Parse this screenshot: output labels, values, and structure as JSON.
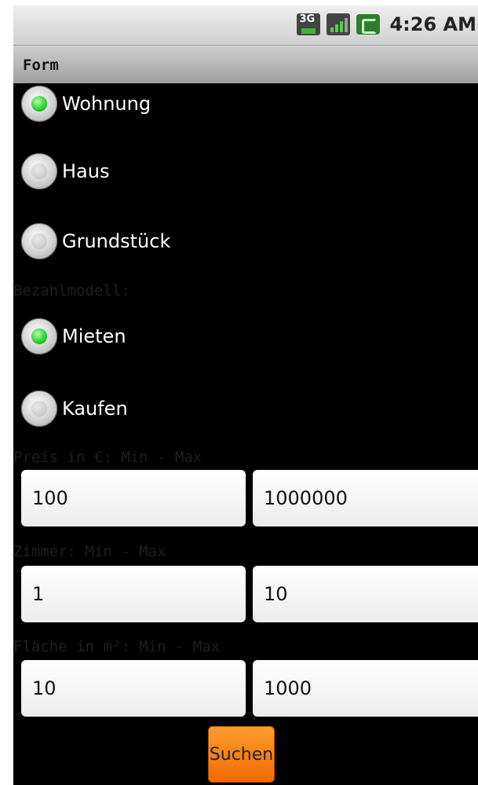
{
  "status_bar": {
    "network": "3G",
    "time": "4:26 AM",
    "icons": [
      "3g-icon",
      "signal-icon",
      "battery-icon"
    ]
  },
  "title": "Form",
  "property_type": {
    "options": [
      {
        "label": "Wohnung",
        "checked": true
      },
      {
        "label": "Haus",
        "checked": false
      },
      {
        "label": "Grundstück",
        "checked": false
      }
    ]
  },
  "payment": {
    "label": "Bezahlmodell:",
    "options": [
      {
        "label": "Mieten",
        "checked": true
      },
      {
        "label": "Kaufen",
        "checked": false
      }
    ]
  },
  "price": {
    "label": "Preis in €: Min - Max",
    "min": "100",
    "max": "1000000"
  },
  "rooms": {
    "label": "Zimmer: Min - Max",
    "min": "1",
    "max": "10"
  },
  "area": {
    "label": "Fläche in m²: Min - Max",
    "min": "10",
    "max": "1000"
  },
  "search_button": "Suchen",
  "colors": {
    "radio_checked": "#2fd32f",
    "button": "#f58220",
    "background": "#000000"
  }
}
